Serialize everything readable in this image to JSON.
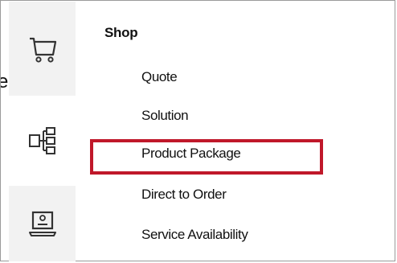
{
  "stray_text": "e",
  "rail": {
    "icons": [
      {
        "name": "cart-icon"
      },
      {
        "name": "hierarchy-icon"
      },
      {
        "name": "laptop-icon"
      }
    ]
  },
  "menu": {
    "title": "Shop",
    "items": [
      {
        "label": "Quote"
      },
      {
        "label": "Solution"
      },
      {
        "label": "Product Package"
      },
      {
        "label": "Direct to Order"
      },
      {
        "label": "Service Availability"
      }
    ]
  },
  "colors": {
    "highlight": "#c0182a",
    "rail_bg": "#f2f2f2"
  }
}
